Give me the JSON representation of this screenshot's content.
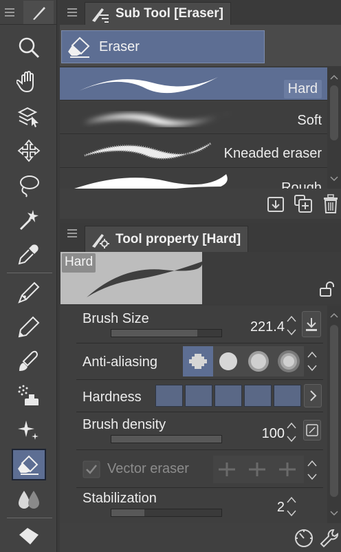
{
  "subtool_panel": {
    "title": "Sub Tool [Eraser]",
    "group_label": "Eraser",
    "items": [
      {
        "label": "Hard",
        "selected": true
      },
      {
        "label": "Soft",
        "selected": false
      },
      {
        "label": "Kneaded eraser",
        "selected": false
      },
      {
        "label": "Rough",
        "selected": false
      }
    ],
    "footer_icons": [
      "copy-subtool-icon",
      "create-subtool-icon",
      "trash-icon"
    ]
  },
  "property_panel": {
    "title": "Tool property [Hard]",
    "preview_name": "Hard",
    "properties": {
      "brush_size": {
        "label": "Brush Size",
        "value": "221.4",
        "fill_fraction": 0.78
      },
      "anti_aliasing": {
        "label": "Anti-aliasing",
        "options": [
          "none",
          "weak",
          "medium",
          "strong"
        ],
        "selected_index": 0
      },
      "hardness": {
        "label": "Hardness",
        "level_count": 5
      },
      "brush_density": {
        "label": "Brush density",
        "value": "100",
        "fill_fraction": 1.0
      },
      "vector_eraser": {
        "label": "Vector eraser",
        "checked": true,
        "enabled": false
      },
      "stabilization": {
        "label": "Stabilization",
        "value": "2",
        "fill_fraction": 0.3
      }
    }
  },
  "toolbar": {
    "tools": [
      "zoom-icon",
      "hand-icon",
      "layer-select-icon",
      "move-icon",
      "lasso-icon",
      "magic-wand-icon",
      "eyedropper-icon",
      "pen-icon",
      "pencil-icon",
      "brush-icon",
      "airbrush-icon",
      "decoration-icon",
      "eraser-icon",
      "blend-icon",
      "fill-icon"
    ],
    "active_tool": "eraser-icon"
  },
  "colors": {
    "accent": "#5d6e93",
    "panel": "#3f3f3f",
    "header": "#3a3a3a"
  }
}
